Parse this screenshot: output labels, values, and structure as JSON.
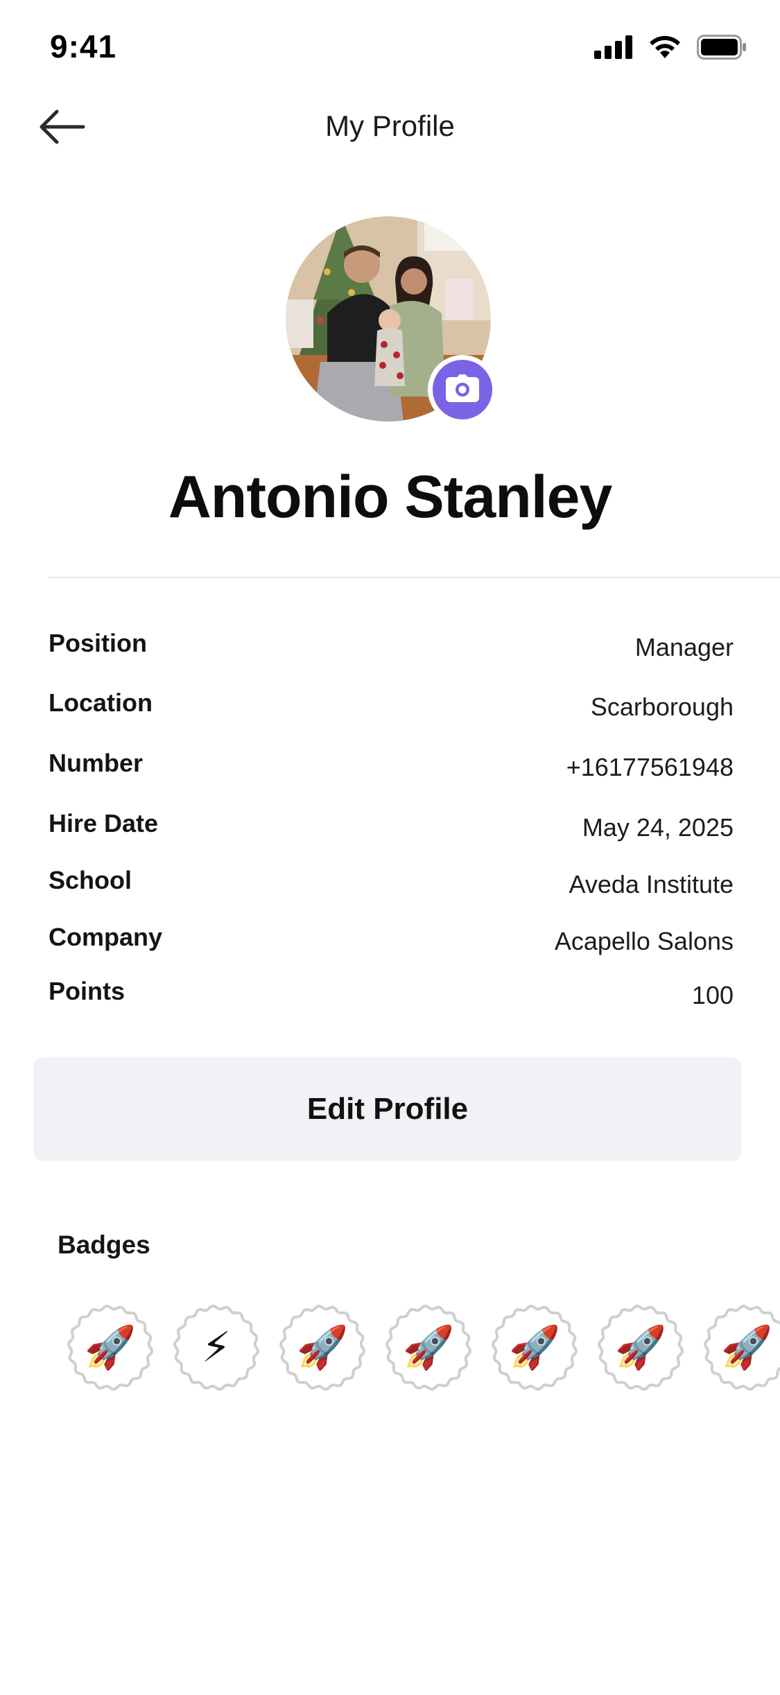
{
  "status_bar": {
    "time": "9:41"
  },
  "nav": {
    "title": "My Profile"
  },
  "profile": {
    "name": "Antonio Stanley"
  },
  "info": [
    {
      "label": "Position",
      "value": "Manager"
    },
    {
      "label": "Location",
      "value": "Scarborough"
    },
    {
      "label": "Number",
      "value": "+16177561948"
    },
    {
      "label": "Hire Date",
      "value": "May 24, 2025"
    },
    {
      "label": "School",
      "value": "Aveda Institute"
    },
    {
      "label": "Company",
      "value": "Acapello Salons"
    },
    {
      "label": "Points",
      "value": "100"
    }
  ],
  "edit_button": {
    "label": "Edit Profile"
  },
  "badges": {
    "title": "Badges",
    "items": [
      {
        "emoji": "🚀",
        "icon": "rocket-icon"
      },
      {
        "emoji": "⚡",
        "icon": "lightning-icon"
      },
      {
        "emoji": "🚀",
        "icon": "rocket-icon"
      },
      {
        "emoji": "🚀",
        "icon": "rocket-icon"
      },
      {
        "emoji": "🚀",
        "icon": "rocket-icon"
      },
      {
        "emoji": "🚀",
        "icon": "rocket-icon"
      },
      {
        "emoji": "🚀",
        "icon": "rocket-icon"
      }
    ]
  },
  "colors": {
    "accent": "#7b63e6",
    "button_bg": "#f1f2f5",
    "badge_ring": "#cfcfcf"
  }
}
